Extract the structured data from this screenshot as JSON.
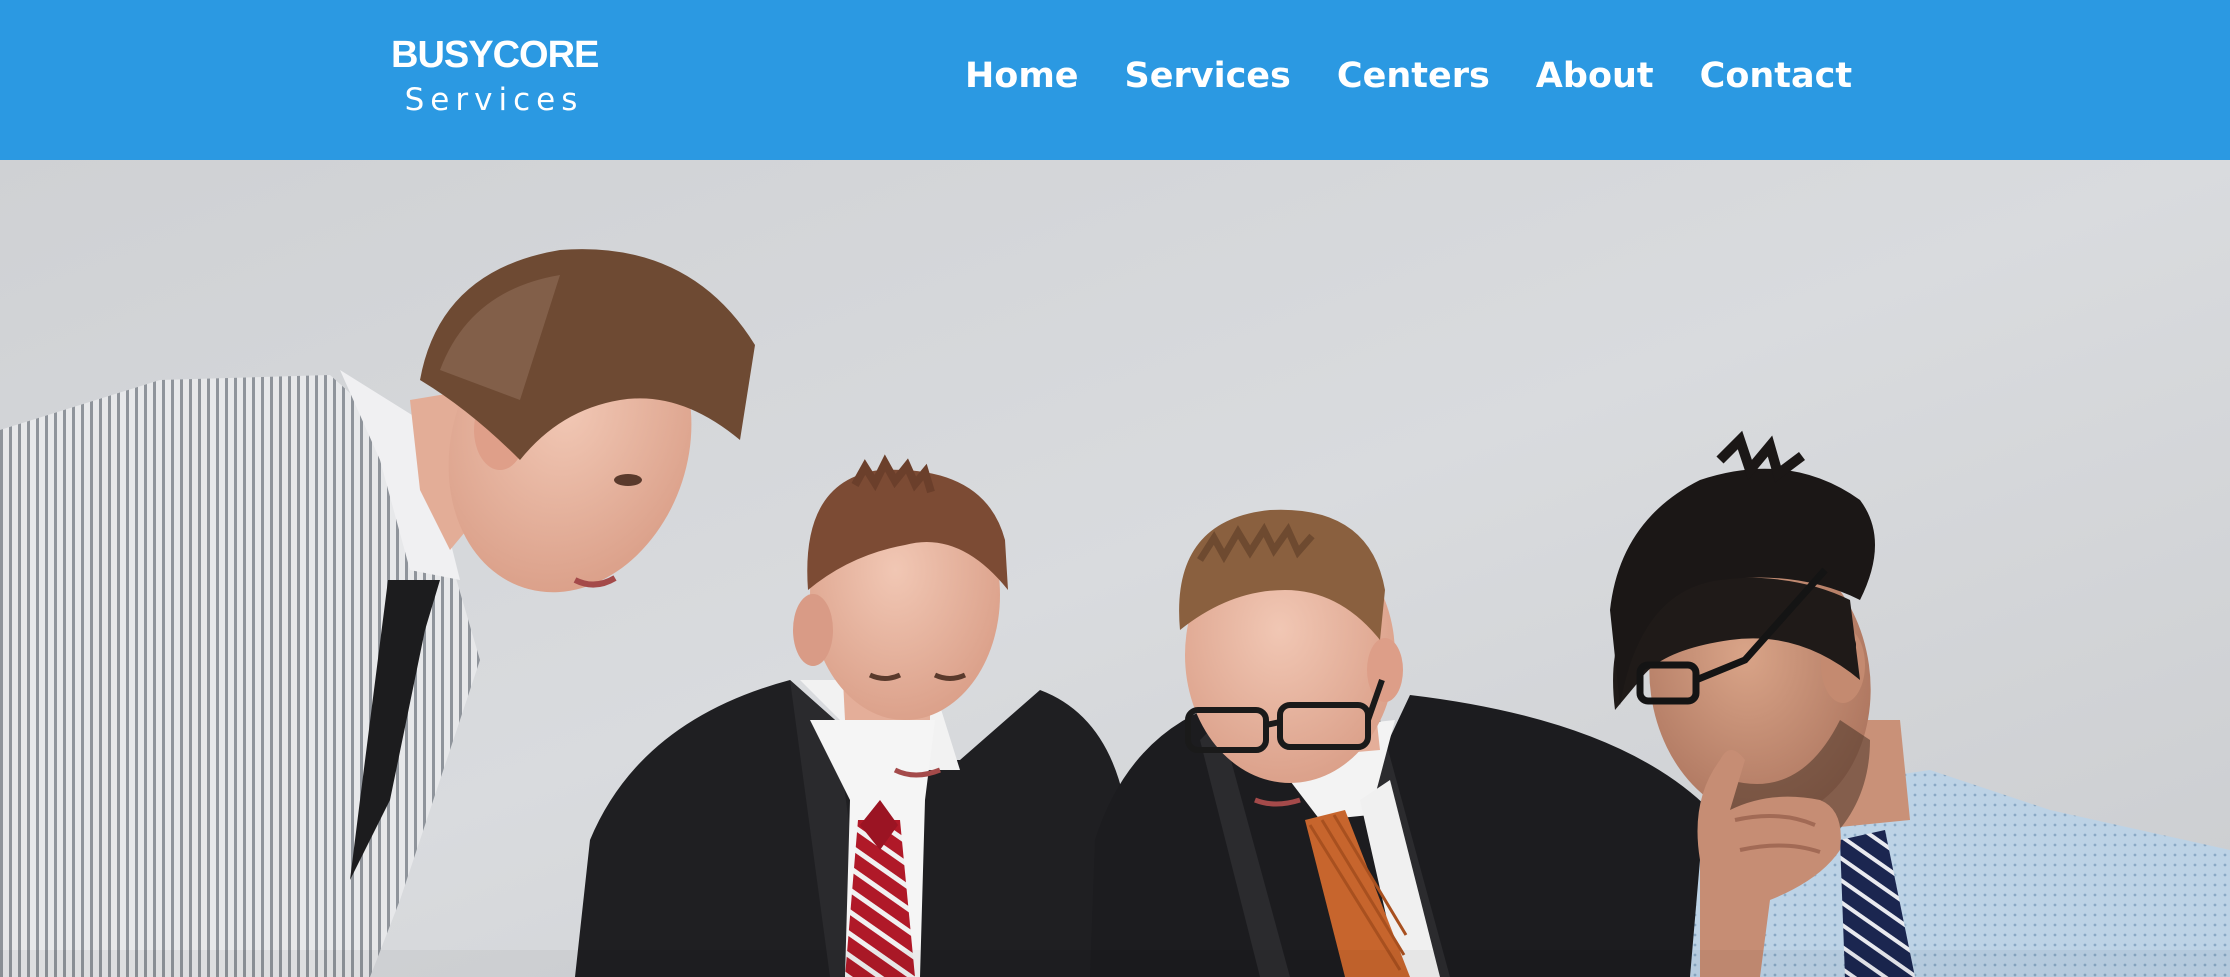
{
  "brand": {
    "name": "BUSYCORE",
    "tagline": "Services"
  },
  "nav": {
    "items": [
      {
        "label": "Home"
      },
      {
        "label": "Services"
      },
      {
        "label": "Centers"
      },
      {
        "label": "About"
      },
      {
        "label": "Contact"
      }
    ]
  },
  "colors": {
    "header_bg": "#2b99e2",
    "nav_text": "#ffffff",
    "hero_wall": "#d7d9dc"
  },
  "hero": {
    "image": "business-team-meeting-photo"
  }
}
